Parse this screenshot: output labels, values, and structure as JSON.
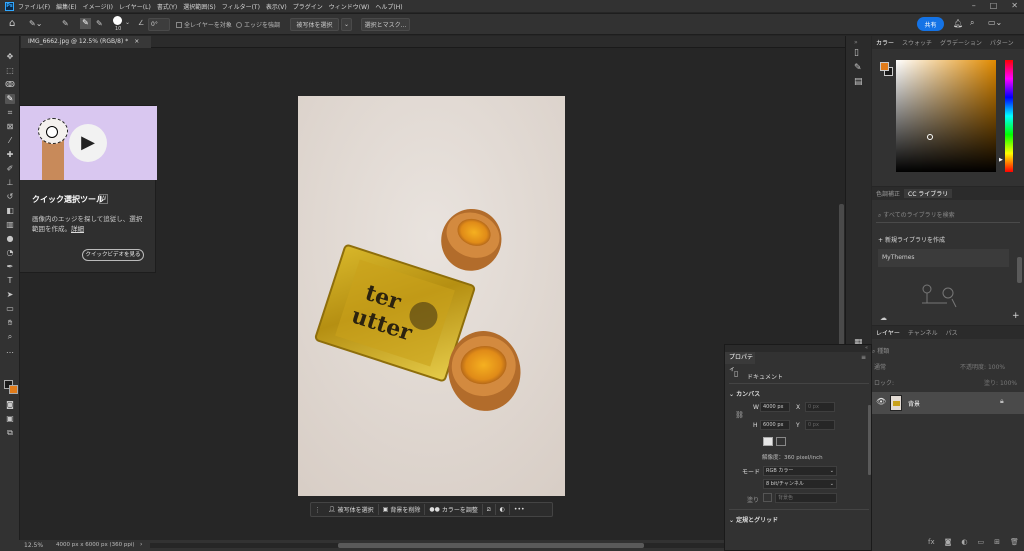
{
  "app": {
    "logo": "Ps"
  },
  "menubar": {
    "items": [
      "ファイル(F)",
      "編集(E)",
      "イメージ(I)",
      "レイヤー(L)",
      "書式(Y)",
      "選択範囲(S)",
      "フィルター(T)",
      "表示(V)",
      "プラグイン",
      "ウィンドウ(W)",
      "ヘルプ(H)"
    ]
  },
  "optionsbar": {
    "brush_size": "10",
    "angle": "0°",
    "sample_all_layers": "全レイヤーを対象",
    "enhance_edge": "エッジを強調",
    "select_subject": "被写体を選択",
    "select_and_mask": "選択とマスク...",
    "share": "共有"
  },
  "document": {
    "tab_title": "IMG_6662.jpg @ 12.5% (RGB/8) *"
  },
  "status": {
    "zoom": "12.5%",
    "size": "4000 px x 6000 px (360 ppi)"
  },
  "tooltip": {
    "title": "クイック選択ツール",
    "shortcut": "W",
    "description": "画像内のエッジを探して追従し、選択範囲を作成。",
    "detail_link": "詳細",
    "video_button": "クイックビデオを見る"
  },
  "context_bar": {
    "select_subject": "被写体を選択",
    "remove_bg": "背景を削除",
    "adjust_color": "カラーを調整"
  },
  "color_panel": {
    "tabs": [
      "カラー",
      "スウォッチ",
      "グラデーション",
      "パターン"
    ],
    "fg_color": "#e07b1a",
    "bg_color": "#1a1a1a",
    "hue_color": "#e08a00"
  },
  "libraries_panel": {
    "tabs": [
      "色調補正",
      "CC ライブラリ"
    ],
    "search_placeholder": "すべてのライブラリを検索",
    "create_new": "新規ライブラリを作成",
    "library_name": "MyThemes"
  },
  "layers_panel": {
    "tabs": [
      "レイヤー",
      "チャンネル",
      "パス"
    ],
    "filter_kind": "種類",
    "blend_mode": "通常",
    "opacity_label": "不透明度:",
    "opacity_value": "100%",
    "lock_label": "ロック:",
    "fill_label": "塗り:",
    "fill_value": "100%",
    "layer_name": "背景"
  },
  "properties_panel": {
    "title": "プロパティ",
    "doc_label": "ドキュメント",
    "canvas_section": "カンバス",
    "w_label": "W",
    "w_value": "4000 px",
    "h_label": "H",
    "h_value": "6000 px",
    "x_label": "X",
    "x_value": "0 px",
    "y_label": "Y",
    "y_value": "0 px",
    "resolution": "解像度：360 pixel/inch",
    "mode_label": "モード",
    "mode_value": "RGB カラー",
    "depth_value": "8 bit/チャンネル",
    "fill_label": "塗り",
    "fill_value": "背景色",
    "rulers_section": "定規とグリッド"
  },
  "product": {
    "brand_line1": "ter",
    "brand_line2": "utter"
  }
}
